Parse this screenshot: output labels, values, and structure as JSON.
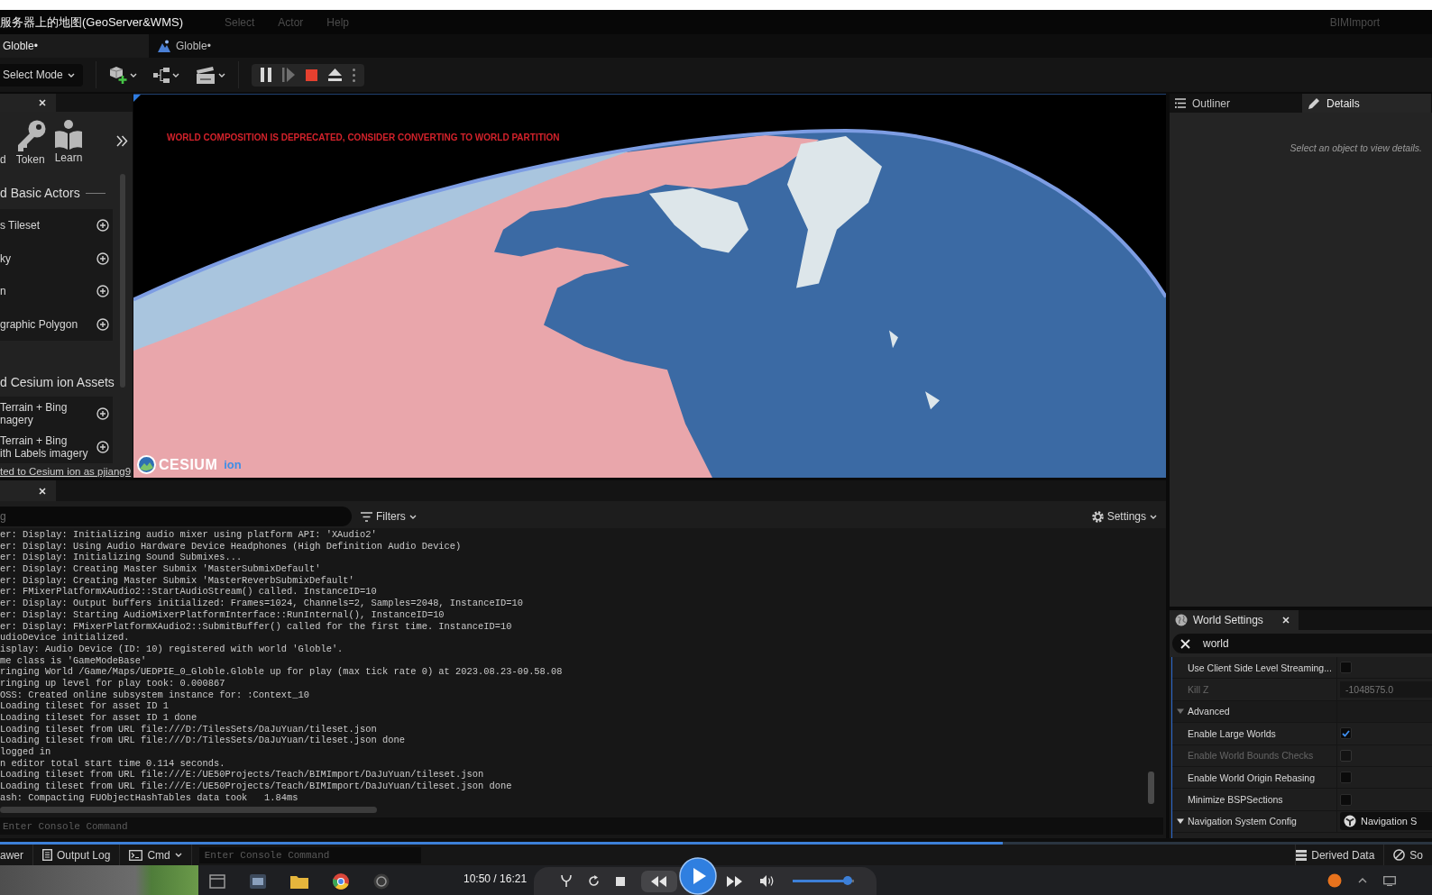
{
  "window": {
    "title": "服务器上的地图(GeoServer&WMS)",
    "menu": [
      {
        "label": "Select"
      },
      {
        "label": "Actor"
      },
      {
        "label": "Help"
      }
    ],
    "project": "BIMImport"
  },
  "tabs": [
    {
      "label": "Globle•",
      "kind": "editor",
      "selected": true
    },
    {
      "label": "Globle•",
      "kind": "level",
      "selected": false
    }
  ],
  "toolbar": {
    "mode": "Select Mode"
  },
  "cesium_panel": {
    "quick_buttons": [
      {
        "label": "d",
        "kind": "partial"
      },
      {
        "label": "Token",
        "kind": "token"
      },
      {
        "label": "Learn",
        "kind": "learn"
      }
    ],
    "sections": [
      {
        "title": "d Basic Actors",
        "items": [
          "s Tileset",
          "ky",
          "n",
          "graphic Polygon"
        ]
      },
      {
        "title": "d Cesium ion Assets",
        "items": [
          "Terrain + Bing\nnagery",
          "Terrain + Bing\nith Labels imagery"
        ]
      }
    ],
    "connection": "ted to Cesium ion as pjiang9"
  },
  "viewport": {
    "warning": "WORLD COMPOSITION IS DEPRECATED, CONSIDER CONVERTING TO WORLD PARTITION",
    "logo": "CESIUM",
    "logo_suffix": "ion"
  },
  "output_log": {
    "search_placeholder": "g",
    "filters": "Filters",
    "settings": "Settings",
    "lines": [
      "er: Display: Initializing audio mixer using platform API: 'XAudio2'",
      "er: Display: Using Audio Hardware Device Headphones (High Definition Audio Device)",
      "er: Display: Initializing Sound Submixes...",
      "er: Display: Creating Master Submix 'MasterSubmixDefault'",
      "er: Display: Creating Master Submix 'MasterReverbSubmixDefault'",
      "er: FMixerPlatformXAudio2::StartAudioStream() called. InstanceID=10",
      "er: Display: Output buffers initialized: Frames=1024, Channels=2, Samples=2048, InstanceID=10",
      "er: Display: Starting AudioMixerPlatformInterface::RunInternal(), InstanceID=10",
      "er: Display: FMixerPlatformXAudio2::SubmitBuffer() called for the first time. InstanceID=10",
      "udioDevice initialized.",
      "isplay: Audio Device (ID: 10) registered with world 'Globle'.",
      "me class is 'GameModeBase'",
      "ringing World /Game/Maps/UEDPIE_0_Globle.Globle up for play (max tick rate 0) at 2023.08.23-09.58.08",
      "ringing up level for play took: 0.000867",
      "OSS: Created online subsystem instance for: :Context_10",
      "Loading tileset for asset ID 1",
      "Loading tileset for asset ID 1 done",
      "Loading tileset from URL file:///D:/TilesSets/DaJuYuan/tileset.json",
      "Loading tileset from URL file:///D:/TilesSets/DaJuYuan/tileset.json done",
      "logged in",
      "n editor total start time 0.114 seconds.",
      "Loading tileset from URL file:///E:/UE50Projects/Teach/BIMImport/DaJuYuan/tileset.json",
      "Loading tileset from URL file:///E:/UE50Projects/Teach/BIMImport/DaJuYuan/tileset.json done",
      "ash: Compacting FUObjectHashTables data took   1.84ms"
    ],
    "command_placeholder": "Enter Console Command"
  },
  "outliner": {
    "tabs": [
      {
        "label": "Outliner",
        "kind": "list",
        "selected": false
      },
      {
        "label": "Details",
        "kind": "details",
        "selected": true
      }
    ],
    "message": "Select an object to view details."
  },
  "world_settings": {
    "title": "World Settings",
    "search": "world",
    "properties": [
      {
        "kind": "check",
        "label": "Use Client Side Level Streaming...",
        "checked": false,
        "disabled": false
      },
      {
        "kind": "number",
        "label": "Kill Z",
        "value": "-1048575.0",
        "disabled": true
      },
      {
        "kind": "category",
        "label": "Advanced",
        "expanded": true
      },
      {
        "kind": "check",
        "label": "Enable Large Worlds",
        "checked": true,
        "disabled": false
      },
      {
        "kind": "check",
        "label": "Enable World Bounds Checks",
        "checked": false,
        "disabled": true
      },
      {
        "kind": "check",
        "label": "Enable World Origin Rebasing",
        "checked": false,
        "disabled": false
      },
      {
        "kind": "check",
        "label": "Minimize BSPSections",
        "checked": false,
        "disabled": false
      },
      {
        "kind": "asset",
        "label": "Navigation System Config",
        "value": "Navigation S",
        "expanded": true
      }
    ]
  },
  "status_bar": {
    "left": [
      {
        "label": "awer",
        "kind": "drawer"
      },
      {
        "label": "Output Log",
        "kind": "log"
      },
      {
        "label": "Cmd",
        "kind": "cmd"
      }
    ],
    "command_placeholder": "Enter Console Command",
    "right": [
      {
        "label": "Derived Data",
        "kind": "data"
      },
      {
        "label": "So",
        "kind": "source"
      }
    ]
  },
  "video_player": {
    "seek": {
      "level": 0.7
    },
    "time": "10:50 / 16:21",
    "volume": {
      "level": 0.9
    }
  }
}
